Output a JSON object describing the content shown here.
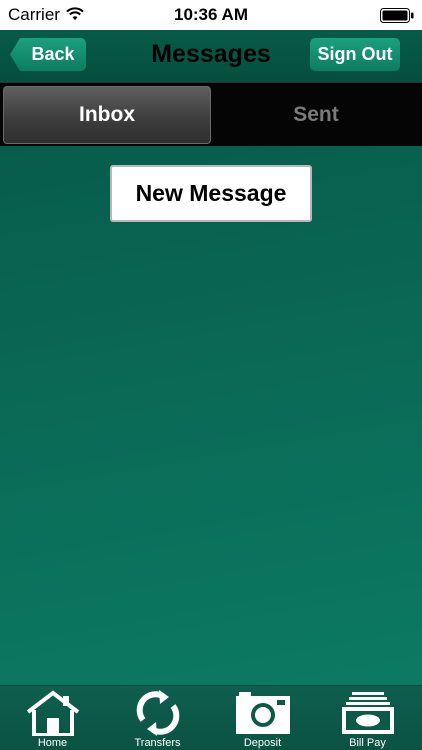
{
  "status_bar": {
    "carrier": "Carrier",
    "time": "10:36 AM"
  },
  "nav": {
    "back_label": "Back",
    "title": "Messages",
    "signout_label": "Sign Out"
  },
  "tabs": [
    {
      "label": "Inbox",
      "selected": true
    },
    {
      "label": "Sent",
      "selected": false
    }
  ],
  "main": {
    "new_message_label": "New Message"
  },
  "tabbar": [
    {
      "label": "Home",
      "icon": "house-icon"
    },
    {
      "label": "Transfers",
      "icon": "refresh-arrows-icon"
    },
    {
      "label": "Deposit",
      "icon": "camera-icon"
    },
    {
      "label": "Bill Pay",
      "icon": "cash-stack-icon"
    }
  ],
  "colors": {
    "accent_green": "#0d7d60",
    "background_teal": "#0b6a57"
  }
}
